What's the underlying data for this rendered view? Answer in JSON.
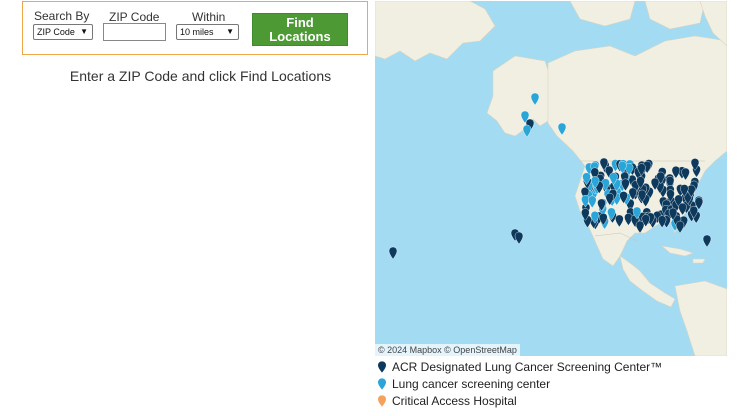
{
  "search": {
    "search_by_label": "Search By",
    "search_by_value": "ZIP Code",
    "zip_label": "ZIP Code",
    "zip_value": "",
    "within_label": "Within",
    "within_value": "10 miles",
    "find_button_label": "Find Locations"
  },
  "instruction": "Enter a ZIP Code and click Find Locations",
  "map": {
    "attribution": "© 2024 Mapbox © OpenStreetMap",
    "colors": {
      "water": "#a3dbf3",
      "land": "#f2f0e4",
      "acr": "#0d3a5c",
      "screening": "#2aa5d8",
      "critical": "#f4a25b"
    }
  },
  "legend": [
    {
      "label": "ACR Designated Lung Cancer Screening Center™",
      "color": "#0d3a5c",
      "icon": "map-pin-icon"
    },
    {
      "label": "Lung cancer screening center",
      "color": "#2aa5d8",
      "icon": "map-pin-icon"
    },
    {
      "label": "Critical Access Hospital",
      "color": "#f4a25b",
      "icon": "map-pin-icon"
    }
  ]
}
